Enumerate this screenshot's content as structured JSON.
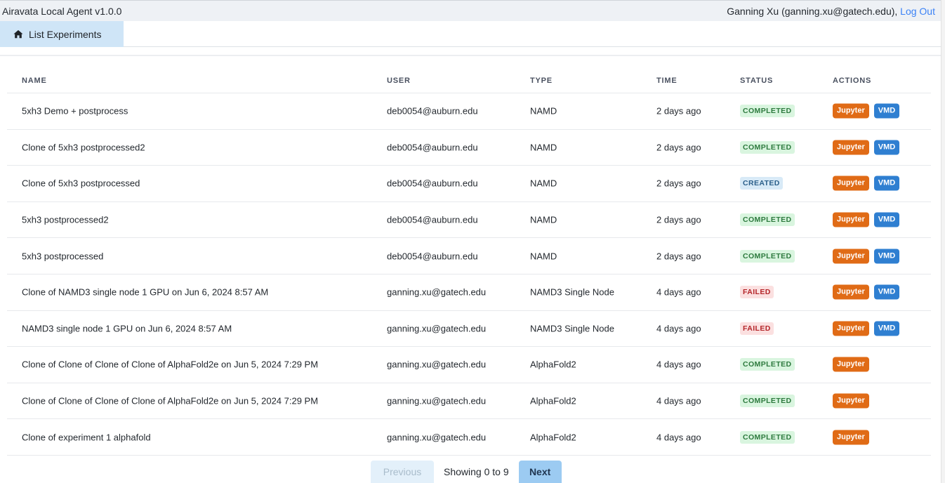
{
  "app": {
    "title": "Airavata Local Agent v1.0.0"
  },
  "user": {
    "label": "Ganning Xu (ganning.xu@gatech.edu),",
    "logout": "Log Out"
  },
  "nav": {
    "tab_label": "List Experiments",
    "tab_icon": "home-icon"
  },
  "table": {
    "headers": [
      "NAME",
      "USER",
      "TYPE",
      "TIME",
      "STATUS",
      "ACTIONS"
    ],
    "rows": [
      {
        "name": "5xh3 Demo + postprocess",
        "user": "deb0054@auburn.edu",
        "type": "NAMD",
        "time": "2 days ago",
        "status": "COMPLETED",
        "actions": [
          "Jupyter",
          "VMD"
        ]
      },
      {
        "name": "Clone of 5xh3 postprocessed2",
        "user": "deb0054@auburn.edu",
        "type": "NAMD",
        "time": "2 days ago",
        "status": "COMPLETED",
        "actions": [
          "Jupyter",
          "VMD"
        ]
      },
      {
        "name": "Clone of 5xh3 postprocessed",
        "user": "deb0054@auburn.edu",
        "type": "NAMD",
        "time": "2 days ago",
        "status": "CREATED",
        "actions": [
          "Jupyter",
          "VMD"
        ]
      },
      {
        "name": "5xh3 postprocessed2",
        "user": "deb0054@auburn.edu",
        "type": "NAMD",
        "time": "2 days ago",
        "status": "COMPLETED",
        "actions": [
          "Jupyter",
          "VMD"
        ]
      },
      {
        "name": "5xh3 postprocessed",
        "user": "deb0054@auburn.edu",
        "type": "NAMD",
        "time": "2 days ago",
        "status": "COMPLETED",
        "actions": [
          "Jupyter",
          "VMD"
        ]
      },
      {
        "name": "Clone of NAMD3 single node 1 GPU on Jun 6, 2024 8:57 AM",
        "user": "ganning.xu@gatech.edu",
        "type": "NAMD3 Single Node",
        "time": "4 days ago",
        "status": "FAILED",
        "actions": [
          "Jupyter",
          "VMD"
        ]
      },
      {
        "name": "NAMD3 single node 1 GPU on Jun 6, 2024 8:57 AM",
        "user": "ganning.xu@gatech.edu",
        "type": "NAMD3 Single Node",
        "time": "4 days ago",
        "status": "FAILED",
        "actions": [
          "Jupyter",
          "VMD"
        ]
      },
      {
        "name": "Clone of Clone of Clone of Clone of AlphaFold2e on Jun 5, 2024 7:29 PM",
        "user": "ganning.xu@gatech.edu",
        "type": "AlphaFold2",
        "time": "4 days ago",
        "status": "COMPLETED",
        "actions": [
          "Jupyter"
        ]
      },
      {
        "name": "Clone of Clone of Clone of Clone of AlphaFold2e on Jun 5, 2024 7:29 PM",
        "user": "ganning.xu@gatech.edu",
        "type": "AlphaFold2",
        "time": "4 days ago",
        "status": "COMPLETED",
        "actions": [
          "Jupyter"
        ]
      },
      {
        "name": "Clone of experiment 1 alphafold",
        "user": "ganning.xu@gatech.edu",
        "type": "AlphaFold2",
        "time": "4 days ago",
        "status": "COMPLETED",
        "actions": [
          "Jupyter"
        ]
      }
    ]
  },
  "pagination": {
    "previous": "Previous",
    "info": "Showing 0 to 9",
    "next": "Next"
  },
  "colors": {
    "completed": "#2d7a3e",
    "created": "#2b5f8a",
    "failed": "#b4262a",
    "jupyter": "#e06b16",
    "vmd": "#2f7fd1",
    "link": "#3b82f6"
  }
}
